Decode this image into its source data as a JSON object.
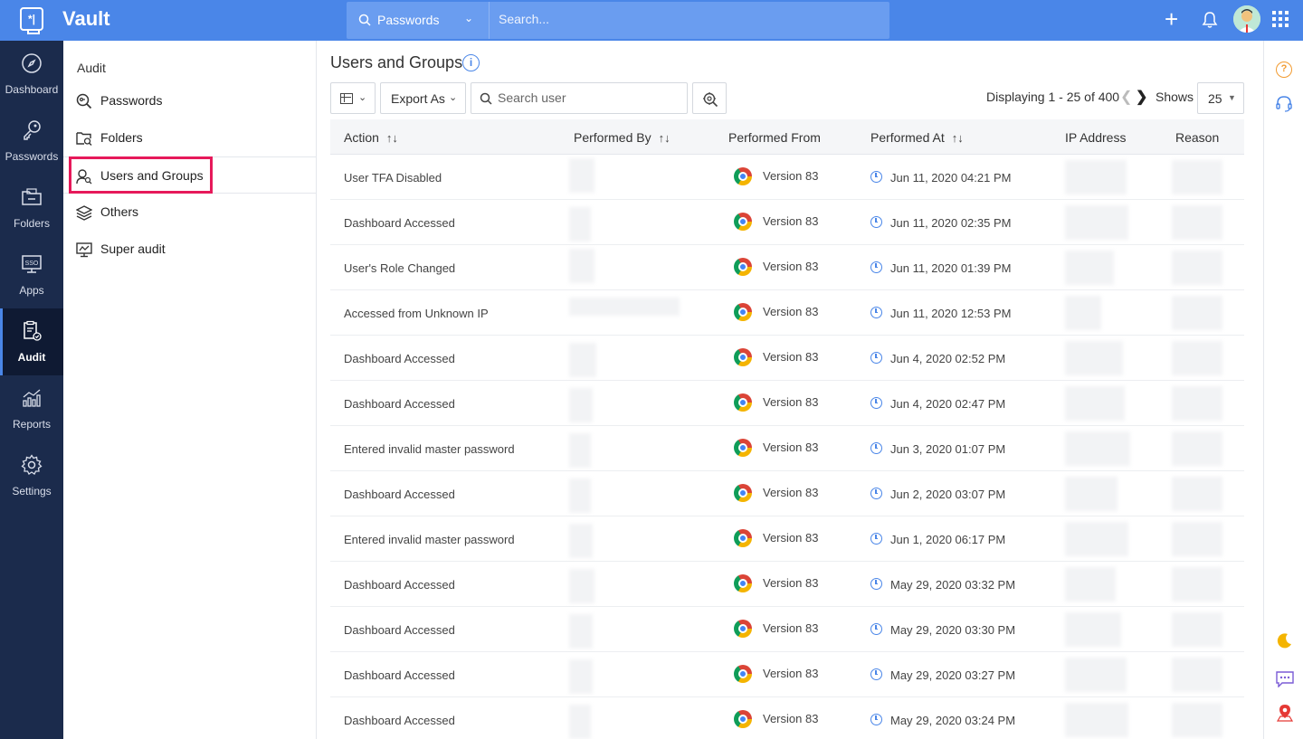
{
  "app": {
    "name": "Vault"
  },
  "topbar": {
    "search_scope": "Passwords",
    "search_placeholder": "Search..."
  },
  "leftnav": {
    "items": [
      {
        "label": "Dashboard",
        "icon": "compass-icon"
      },
      {
        "label": "Passwords",
        "icon": "key-icon"
      },
      {
        "label": "Folders",
        "icon": "folder-icon"
      },
      {
        "label": "Apps",
        "icon": "sso-icon"
      },
      {
        "label": "Audit",
        "icon": "clipboard-icon",
        "active": true
      },
      {
        "label": "Reports",
        "icon": "chart-icon"
      },
      {
        "label": "Settings",
        "icon": "gear-icon"
      }
    ]
  },
  "subnav": {
    "title": "Audit",
    "items": [
      {
        "label": "Passwords",
        "icon": "search-key-icon"
      },
      {
        "label": "Folders",
        "icon": "folder-search-icon"
      },
      {
        "label": "Users and Groups",
        "icon": "user-search-icon",
        "active": true
      },
      {
        "label": "Others",
        "icon": "layers-icon"
      },
      {
        "label": "Super audit",
        "icon": "monitor-chart-icon"
      }
    ]
  },
  "main": {
    "title": "Users and Groups",
    "toolbar": {
      "export_label": "Export As",
      "search_placeholder": "Search user"
    },
    "pager": {
      "display_text": "Displaying 1 - 25 of 400",
      "shows_label": "Shows",
      "page_size": "25"
    },
    "table": {
      "columns": [
        "Action",
        "Performed By",
        "Performed From",
        "Performed At",
        "IP Address",
        "Reason"
      ],
      "rows": [
        {
          "action": "User TFA Disabled",
          "from": "Version 83",
          "at": "Jun 11, 2020 04:21 PM"
        },
        {
          "action": "Dashboard Accessed",
          "from": "Version 83",
          "at": "Jun 11, 2020 02:35 PM"
        },
        {
          "action": "User's Role Changed",
          "from": "Version 83",
          "at": "Jun 11, 2020 01:39 PM"
        },
        {
          "action": "Accessed from Unknown IP",
          "from": "Version 83",
          "at": "Jun 11, 2020 12:53 PM"
        },
        {
          "action": "Dashboard Accessed",
          "from": "Version 83",
          "at": "Jun 4, 2020 02:52 PM"
        },
        {
          "action": "Dashboard Accessed",
          "from": "Version 83",
          "at": "Jun 4, 2020 02:47 PM"
        },
        {
          "action": "Entered invalid master password",
          "from": "Version 83",
          "at": "Jun 3, 2020 01:07 PM"
        },
        {
          "action": "Dashboard Accessed",
          "from": "Version 83",
          "at": "Jun 2, 2020 03:07 PM"
        },
        {
          "action": "Entered invalid master password",
          "from": "Version 83",
          "at": "Jun 1, 2020 06:17 PM"
        },
        {
          "action": "Dashboard Accessed",
          "from": "Version 83",
          "at": "May 29, 2020 03:32 PM"
        },
        {
          "action": "Dashboard Accessed",
          "from": "Version 83",
          "at": "May 29, 2020 03:30 PM"
        },
        {
          "action": "Dashboard Accessed",
          "from": "Version 83",
          "at": "May 29, 2020 03:27 PM"
        },
        {
          "action": "Dashboard Accessed",
          "from": "Version 83",
          "at": "May 29, 2020 03:24 PM"
        }
      ]
    }
  },
  "colors": {
    "topbar": "#4a86e8",
    "leftnav": "#1b2b4c",
    "highlight": "#e6195a",
    "accent": "#4a86e8"
  }
}
